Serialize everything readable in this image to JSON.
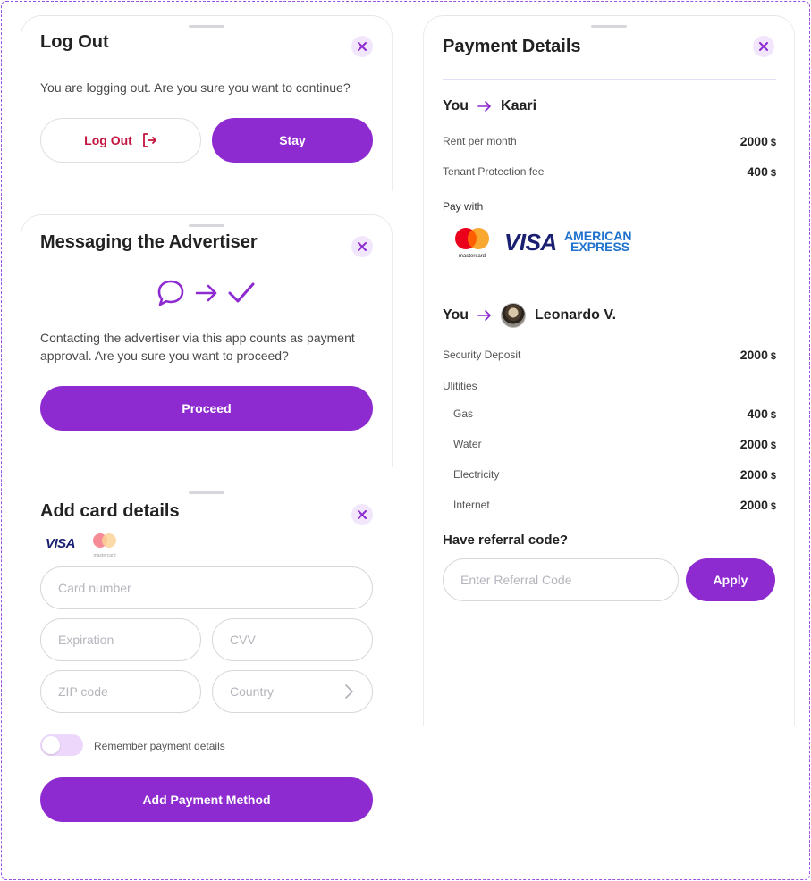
{
  "logout_sheet": {
    "title": "Log Out",
    "message": "You are logging out. Are you sure you want to continue?",
    "logout_label": "Log Out",
    "stay_label": "Stay"
  },
  "messaging_sheet": {
    "title": "Messaging the Advertiser",
    "message_line1": "Contacting the advertiser via this app counts as payment",
    "message_line2": "approval. Are you sure you want to proceed?",
    "proceed_label": "Proceed"
  },
  "card_sheet": {
    "title": "Add card details",
    "visa_label": "VISA",
    "mastercard_caption": "mastercard",
    "card_number_placeholder": "Card number",
    "expiration_placeholder": "Expiration",
    "cvv_placeholder": "CVV",
    "zip_placeholder": "ZIP code",
    "country_placeholder": "Country",
    "remember_label": "Remember payment details",
    "remember_enabled": false,
    "submit_label": "Add Payment Method"
  },
  "payment_sheet": {
    "title": "Payment Details",
    "first_party": {
      "from": "You",
      "to": "Kaari"
    },
    "first_items": [
      {
        "label": "Rent per month",
        "amount": "2000",
        "currency": "$"
      },
      {
        "label": "Tenant Protection fee",
        "amount": "400",
        "currency": "$"
      }
    ],
    "pay_with_label": "Pay with",
    "mastercard_caption": "mastercard",
    "visa_label": "VISA",
    "amex_line1": "AMERICAN",
    "amex_line2": "EXPRESS",
    "second_party": {
      "from": "You",
      "to": "Leonardo V."
    },
    "deposit": {
      "label": "Security Deposit",
      "amount": "2000",
      "currency": "$"
    },
    "utilities_label": "Ulitities",
    "utilities": [
      {
        "label": "Gas",
        "amount": "400",
        "currency": "$"
      },
      {
        "label": "Water",
        "amount": "2000",
        "currency": "$"
      },
      {
        "label": "Electricity",
        "amount": "2000",
        "currency": "$"
      },
      {
        "label": "Internet",
        "amount": "2000",
        "currency": "$"
      }
    ],
    "referral_heading": "Have referral code?",
    "referral_placeholder": "Enter Referral Code",
    "apply_label": "Apply"
  },
  "colors": {
    "accent": "#8e2bd0",
    "danger": "#c2153f",
    "close_bg": "#f1e6fb"
  }
}
